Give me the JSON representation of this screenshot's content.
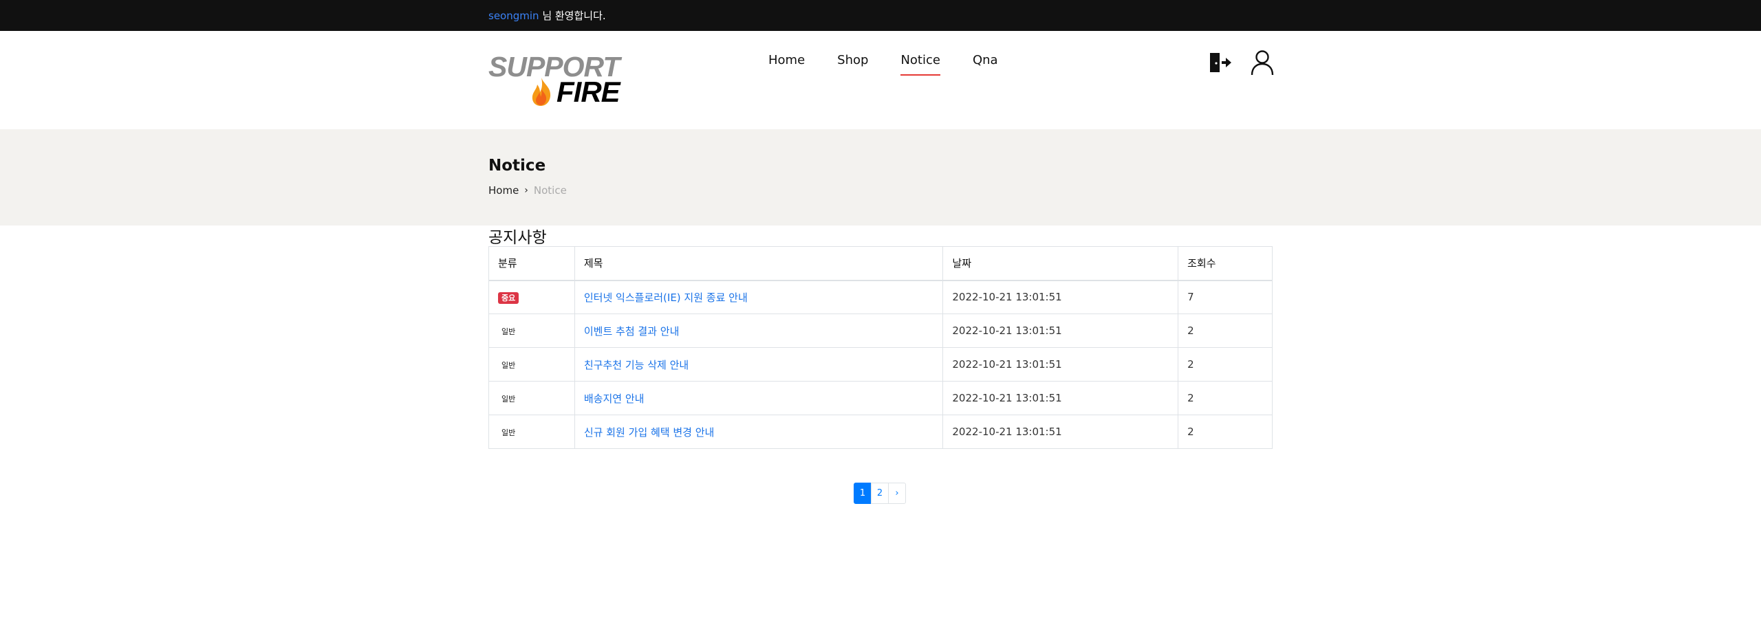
{
  "topbar": {
    "username": "seongmin",
    "welcome_suffix": " 님 환영합니다."
  },
  "logo": {
    "line1": "SUPPORT",
    "line2": "FIRE"
  },
  "nav": [
    {
      "label": "Home",
      "active": false
    },
    {
      "label": "Shop",
      "active": false
    },
    {
      "label": "Notice",
      "active": true
    },
    {
      "label": "Qna",
      "active": false
    }
  ],
  "header_icons": [
    "logout-icon",
    "user-icon"
  ],
  "banner": {
    "title": "Notice",
    "crumb_home": "Home",
    "crumb_current": "Notice"
  },
  "section_title": "공지사항",
  "table": {
    "headers": [
      "분류",
      "제목",
      "날짜",
      "조회수"
    ],
    "rows": [
      {
        "category": "중요",
        "important": true,
        "title": "인터넷 익스플로러(IE) 지원 종료 안내",
        "date": "2022-10-21 13:01:51",
        "views": "7"
      },
      {
        "category": "일반",
        "important": false,
        "title": "이벤트 추첨 결과 안내",
        "date": "2022-10-21 13:01:51",
        "views": "2"
      },
      {
        "category": "일반",
        "important": false,
        "title": "친구추천 기능 삭제 안내",
        "date": "2022-10-21 13:01:51",
        "views": "2"
      },
      {
        "category": "일반",
        "important": false,
        "title": "배송지연 안내",
        "date": "2022-10-21 13:01:51",
        "views": "2"
      },
      {
        "category": "일반",
        "important": false,
        "title": "신규 회원 가입 혜택 변경 안내",
        "date": "2022-10-21 13:01:51",
        "views": "2"
      }
    ]
  },
  "pagination": {
    "pages": [
      "1",
      "2"
    ],
    "current": "1",
    "next_label": "›"
  },
  "colors": {
    "topbar_bg": "#111111",
    "banner_bg": "#f3f2ef",
    "accent_blue": "#007bff",
    "nav_active_underline": "#e53935",
    "badge_red": "#dc3545"
  }
}
